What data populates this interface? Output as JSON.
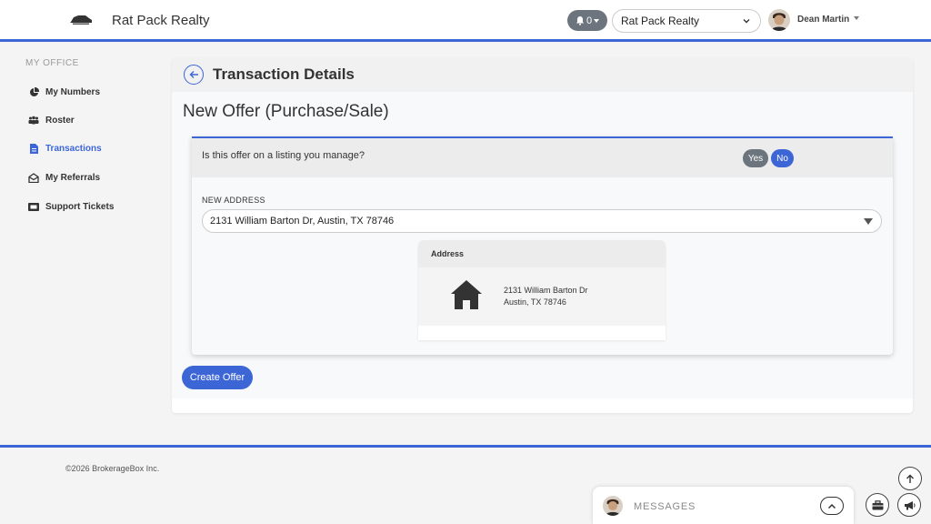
{
  "header": {
    "brand": "Rat Pack Realty",
    "logo_icon": "car-logo-icon",
    "notifications_count": "0",
    "office_select": "Rat Pack Realty",
    "user_name": "Dean Martin"
  },
  "sidebar": {
    "heading": "MY OFFICE",
    "items": [
      {
        "label": "My Numbers",
        "icon": "pie-chart-icon",
        "active": false
      },
      {
        "label": "Roster",
        "icon": "users-icon",
        "active": false
      },
      {
        "label": "Transactions",
        "icon": "file-icon",
        "active": true
      },
      {
        "label": "My Referrals",
        "icon": "envelope-open-icon",
        "active": false
      },
      {
        "label": "Support Tickets",
        "icon": "ticket-icon",
        "active": false
      }
    ]
  },
  "main": {
    "title": "Transaction Details",
    "subtitle": "New Offer (Purchase/Sale)",
    "question": "Is this offer on a listing you manage?",
    "yes_label": "Yes",
    "no_label": "No",
    "selected_answer": "No",
    "new_address_label": "NEW ADDRESS",
    "new_address_value": "2131 William Barton Dr, Austin, TX 78746",
    "address_card": {
      "title": "Address",
      "line1": "2131 William Barton Dr",
      "line2": "Austin, TX 78746"
    },
    "create_button": "Create Offer"
  },
  "footer": {
    "copyright": "©2026 BrokerageBox Inc.",
    "messages_label": "MESSAGES"
  },
  "colors": {
    "accent": "#3c66d6",
    "secondary": "#6c757d"
  }
}
